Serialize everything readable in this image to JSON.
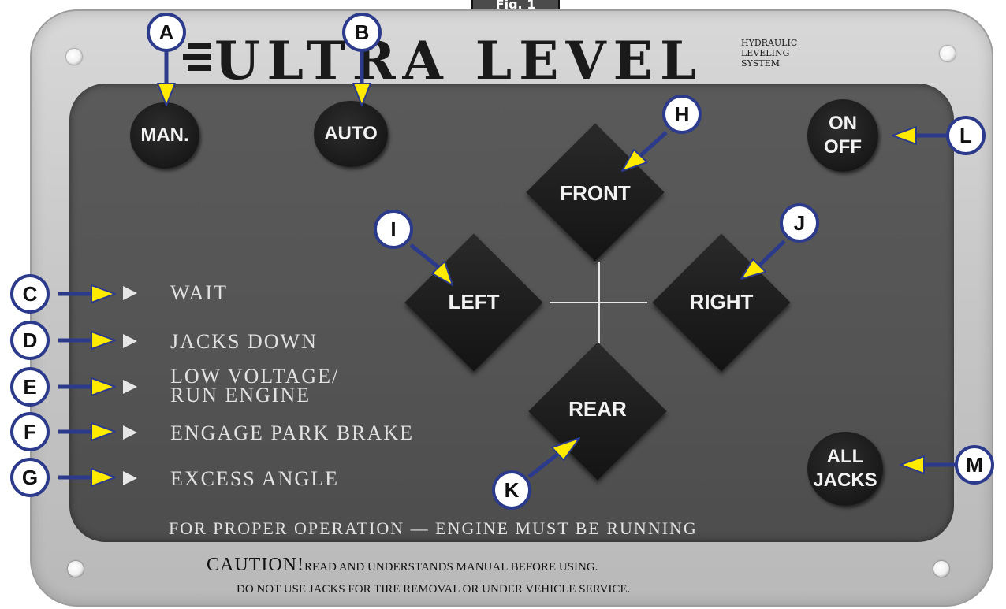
{
  "figure_tab": "Fig. 1",
  "brand": {
    "name": "ULTRA LEVEL",
    "subtitle": "HYDRAULIC\nLEVELING\nSYSTEM"
  },
  "buttons": {
    "manual": "MAN.",
    "auto": "AUTO",
    "power_line1": "ON",
    "power_line2": "OFF",
    "all_jacks_line1": "ALL",
    "all_jacks_line2": "JACKS",
    "front": "FRONT",
    "left": "LEFT",
    "right": "RIGHT",
    "rear": "REAR"
  },
  "indicators": [
    {
      "label": "WAIT"
    },
    {
      "label": "JACKS DOWN"
    },
    {
      "label": "LOW VOLTAGE/\nRUN ENGINE"
    },
    {
      "label": "ENGAGE PARK BRAKE"
    },
    {
      "label": "EXCESS ANGLE"
    }
  ],
  "notice": "FOR PROPER OPERATION — ENGINE MUST BE RUNNING",
  "caution": {
    "heading": "CAUTION!",
    "line1": "READ AND UNDERSTANDS MANUAL BEFORE USING.",
    "line2": "DO NOT USE JACKS FOR TIRE REMOVAL OR UNDER VEHICLE SERVICE."
  },
  "callouts": {
    "a": "A",
    "b": "B",
    "c": "C",
    "d": "D",
    "e": "E",
    "f": "F",
    "g": "G",
    "h": "H",
    "i": "I",
    "j": "J",
    "k": "K",
    "l": "L",
    "m": "M"
  },
  "colors": {
    "callout_border": "#2c3a8c",
    "callout_arrow": "#ffea00",
    "panel": "#555555",
    "plate": "#c8c8c8",
    "button": "#1a1a1a"
  }
}
